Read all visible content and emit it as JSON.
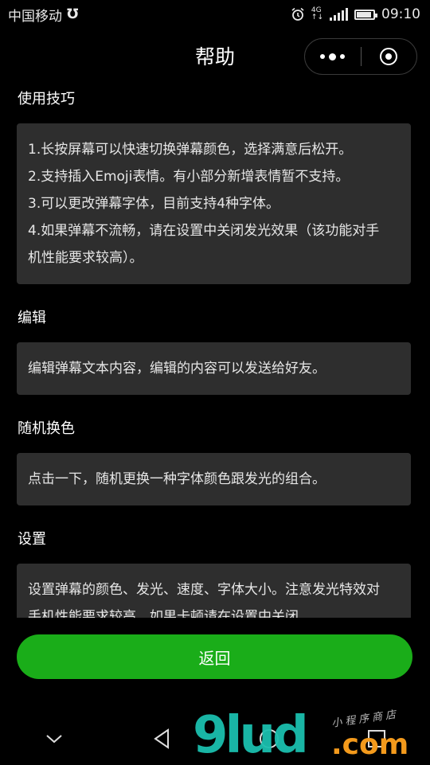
{
  "status_bar": {
    "carrier": "中国移动",
    "net_type": "4G",
    "time": "09:10",
    "battery_level": 0.9
  },
  "nav": {
    "title": "帮助"
  },
  "sections": [
    {
      "title": "使用技巧",
      "lines": [
        "1.长按屏幕可以快速切换弹幕颜色，选择满意后松开。",
        "2.支持插入Emoji表情。有小部分新增表情暂不支持。",
        "3.可以更改弹幕字体，目前支持4种字体。",
        "4.如果弹幕不流畅，请在设置中关闭发光效果（该功能对手",
        "机性能要求较高）。"
      ]
    },
    {
      "title": "编辑",
      "lines": [
        "编辑弹幕文本内容，编辑的内容可以发送给好友。"
      ]
    },
    {
      "title": "随机换色",
      "lines": [
        "点击一下，随机更换一种字体颜色跟发光的组合。"
      ]
    },
    {
      "title": "设置",
      "lines": [
        "设置弹幕的颜色、发光、速度、字体大小。注意发光特效对",
        "手机性能要求较高，如果卡顿请在设置中关闭。"
      ]
    }
  ],
  "back_button": {
    "label": "返回"
  },
  "watermark": {
    "main": "9lud",
    "suffix": ".com",
    "small": "小程序商店"
  },
  "colors": {
    "background": "#000000",
    "card": "#2e2e2e",
    "accent_green": "#1aad19"
  }
}
